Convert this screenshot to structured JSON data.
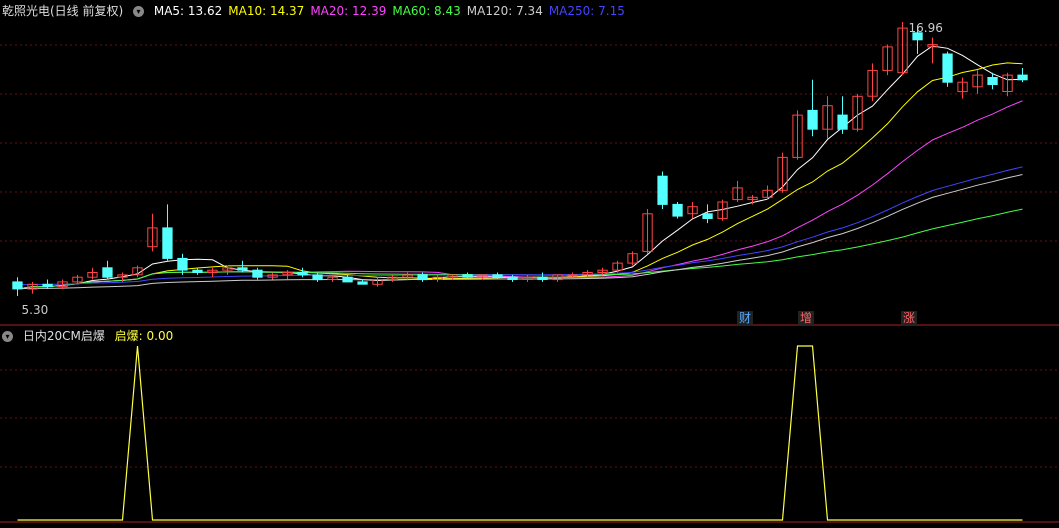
{
  "main_header": {
    "title": "乾照光电(日线 前复权)",
    "ma": [
      {
        "label": "MA5: 13.62",
        "color": "#ffffff"
      },
      {
        "label": "MA10: 14.37",
        "color": "#ffff00"
      },
      {
        "label": "MA20: 12.39",
        "color": "#ff44ff"
      },
      {
        "label": "MA60: 8.43",
        "color": "#44ff44"
      },
      {
        "label": "MA120: 7.34",
        "color": "#cccccc"
      },
      {
        "label": "MA250: 7.15",
        "color": "#4444ff"
      }
    ]
  },
  "annotations": {
    "high_label": "16.96",
    "low_label": "5.30",
    "events": [
      {
        "label": "财",
        "color": "#55aaff"
      },
      {
        "label": "增",
        "color": "#ff6666"
      },
      {
        "label": "涨",
        "color": "#ff6666"
      }
    ]
  },
  "sub_header": {
    "title": "日内20CM启爆",
    "indicator_label": "启爆: 0.00"
  },
  "colors": {
    "up": "#ff4444",
    "down": "#54ffff",
    "grid": "#661111",
    "signal": "#ffff44"
  },
  "chart_data": {
    "type": "candlestick",
    "price_range": [
      5.3,
      16.96
    ],
    "candles": [
      {
        "o": 5.9,
        "h": 6.1,
        "l": 5.3,
        "c": 5.6
      },
      {
        "o": 5.6,
        "h": 5.9,
        "l": 5.4,
        "c": 5.8
      },
      {
        "o": 5.8,
        "h": 6.0,
        "l": 5.6,
        "c": 5.7
      },
      {
        "o": 5.7,
        "h": 6.0,
        "l": 5.6,
        "c": 5.9
      },
      {
        "o": 5.9,
        "h": 6.2,
        "l": 5.8,
        "c": 6.1
      },
      {
        "o": 6.1,
        "h": 6.5,
        "l": 6.0,
        "c": 6.3
      },
      {
        "o": 6.5,
        "h": 6.8,
        "l": 6.0,
        "c": 6.1
      },
      {
        "o": 6.1,
        "h": 6.3,
        "l": 5.9,
        "c": 6.2
      },
      {
        "o": 6.2,
        "h": 6.6,
        "l": 6.1,
        "c": 6.5
      },
      {
        "o": 7.4,
        "h": 8.8,
        "l": 7.2,
        "c": 8.2
      },
      {
        "o": 8.2,
        "h": 9.2,
        "l": 6.8,
        "c": 6.9
      },
      {
        "o": 6.9,
        "h": 7.1,
        "l": 6.2,
        "c": 6.4
      },
      {
        "o": 6.4,
        "h": 6.5,
        "l": 6.2,
        "c": 6.3
      },
      {
        "o": 6.3,
        "h": 6.5,
        "l": 6.1,
        "c": 6.4
      },
      {
        "o": 6.4,
        "h": 6.6,
        "l": 6.2,
        "c": 6.5
      },
      {
        "o": 6.5,
        "h": 6.8,
        "l": 6.3,
        "c": 6.4
      },
      {
        "o": 6.4,
        "h": 6.5,
        "l": 6.0,
        "c": 6.1
      },
      {
        "o": 6.1,
        "h": 6.3,
        "l": 6.0,
        "c": 6.2
      },
      {
        "o": 6.2,
        "h": 6.4,
        "l": 6.0,
        "c": 6.3
      },
      {
        "o": 6.3,
        "h": 6.5,
        "l": 6.1,
        "c": 6.2
      },
      {
        "o": 6.2,
        "h": 6.3,
        "l": 5.9,
        "c": 6.0
      },
      {
        "o": 6.0,
        "h": 6.2,
        "l": 5.9,
        "c": 6.1
      },
      {
        "o": 6.1,
        "h": 6.2,
        "l": 5.9,
        "c": 5.9
      },
      {
        "o": 5.9,
        "h": 6.0,
        "l": 5.8,
        "c": 5.8
      },
      {
        "o": 5.8,
        "h": 6.1,
        "l": 5.7,
        "c": 6.0
      },
      {
        "o": 6.0,
        "h": 6.2,
        "l": 5.9,
        "c": 6.1
      },
      {
        "o": 6.1,
        "h": 6.3,
        "l": 6.0,
        "c": 6.2
      },
      {
        "o": 6.2,
        "h": 6.3,
        "l": 5.9,
        "c": 6.0
      },
      {
        "o": 6.0,
        "h": 6.2,
        "l": 5.9,
        "c": 6.1
      },
      {
        "o": 6.1,
        "h": 6.2,
        "l": 6.0,
        "c": 6.2
      },
      {
        "o": 6.2,
        "h": 6.3,
        "l": 6.0,
        "c": 6.1
      },
      {
        "o": 6.1,
        "h": 6.2,
        "l": 6.0,
        "c": 6.2
      },
      {
        "o": 6.2,
        "h": 6.3,
        "l": 6.0,
        "c": 6.1
      },
      {
        "o": 6.1,
        "h": 6.2,
        "l": 5.9,
        "c": 6.0
      },
      {
        "o": 6.0,
        "h": 6.2,
        "l": 5.9,
        "c": 6.1
      },
      {
        "o": 6.1,
        "h": 6.3,
        "l": 5.9,
        "c": 6.0
      },
      {
        "o": 6.0,
        "h": 6.2,
        "l": 5.9,
        "c": 6.2
      },
      {
        "o": 6.2,
        "h": 6.3,
        "l": 6.1,
        "c": 6.2
      },
      {
        "o": 6.2,
        "h": 6.4,
        "l": 6.1,
        "c": 6.3
      },
      {
        "o": 6.3,
        "h": 6.5,
        "l": 6.2,
        "c": 6.4
      },
      {
        "o": 6.4,
        "h": 6.8,
        "l": 6.3,
        "c": 6.7
      },
      {
        "o": 6.7,
        "h": 7.2,
        "l": 6.6,
        "c": 7.1
      },
      {
        "o": 7.2,
        "h": 9.0,
        "l": 7.1,
        "c": 8.8
      },
      {
        "o": 10.4,
        "h": 10.6,
        "l": 9.0,
        "c": 9.2
      },
      {
        "o": 9.2,
        "h": 9.3,
        "l": 8.6,
        "c": 8.7
      },
      {
        "o": 8.8,
        "h": 9.3,
        "l": 8.6,
        "c": 9.1
      },
      {
        "o": 8.8,
        "h": 9.2,
        "l": 8.4,
        "c": 8.6
      },
      {
        "o": 8.6,
        "h": 9.4,
        "l": 8.5,
        "c": 9.3
      },
      {
        "o": 9.4,
        "h": 10.2,
        "l": 9.3,
        "c": 9.9
      },
      {
        "o": 9.4,
        "h": 9.6,
        "l": 9.2,
        "c": 9.5
      },
      {
        "o": 9.5,
        "h": 10.0,
        "l": 9.4,
        "c": 9.8
      },
      {
        "o": 9.8,
        "h": 11.4,
        "l": 9.7,
        "c": 11.2
      },
      {
        "o": 11.2,
        "h": 13.2,
        "l": 11.1,
        "c": 13.0
      },
      {
        "o": 13.2,
        "h": 14.5,
        "l": 12.1,
        "c": 12.4
      },
      {
        "o": 12.4,
        "h": 13.8,
        "l": 12.0,
        "c": 13.4
      },
      {
        "o": 13.0,
        "h": 13.8,
        "l": 12.2,
        "c": 12.4
      },
      {
        "o": 12.4,
        "h": 13.9,
        "l": 12.3,
        "c": 13.8
      },
      {
        "o": 13.8,
        "h": 15.2,
        "l": 13.6,
        "c": 14.9
      },
      {
        "o": 14.9,
        "h": 16.0,
        "l": 14.7,
        "c": 15.9
      },
      {
        "o": 14.8,
        "h": 16.96,
        "l": 14.7,
        "c": 16.7
      },
      {
        "o": 16.5,
        "h": 16.8,
        "l": 15.6,
        "c": 16.2
      },
      {
        "o": 15.9,
        "h": 16.3,
        "l": 15.2,
        "c": 16.0
      },
      {
        "o": 15.6,
        "h": 15.7,
        "l": 14.2,
        "c": 14.4
      },
      {
        "o": 14.0,
        "h": 14.6,
        "l": 13.7,
        "c": 14.4
      },
      {
        "o": 14.2,
        "h": 14.9,
        "l": 13.9,
        "c": 14.7
      },
      {
        "o": 14.6,
        "h": 14.8,
        "l": 14.1,
        "c": 14.3
      },
      {
        "o": 14.0,
        "h": 14.8,
        "l": 13.8,
        "c": 14.7
      },
      {
        "o": 14.7,
        "h": 15.0,
        "l": 14.4,
        "c": 14.5
      }
    ],
    "signal": [
      0,
      0,
      0,
      0,
      0,
      0,
      0,
      0,
      1,
      0,
      0,
      0,
      0,
      0,
      0,
      0,
      0,
      0,
      0,
      0,
      0,
      0,
      0,
      0,
      0,
      0,
      0,
      0,
      0,
      0,
      0,
      0,
      0,
      0,
      0,
      0,
      0,
      0,
      0,
      0,
      0,
      0,
      0,
      0,
      0,
      0,
      0,
      0,
      0,
      0,
      0,
      0,
      1,
      1,
      0,
      0,
      0,
      0,
      0,
      0,
      0,
      0,
      0,
      0,
      0,
      0,
      0,
      0
    ],
    "signal_range": [
      0,
      1
    ]
  }
}
